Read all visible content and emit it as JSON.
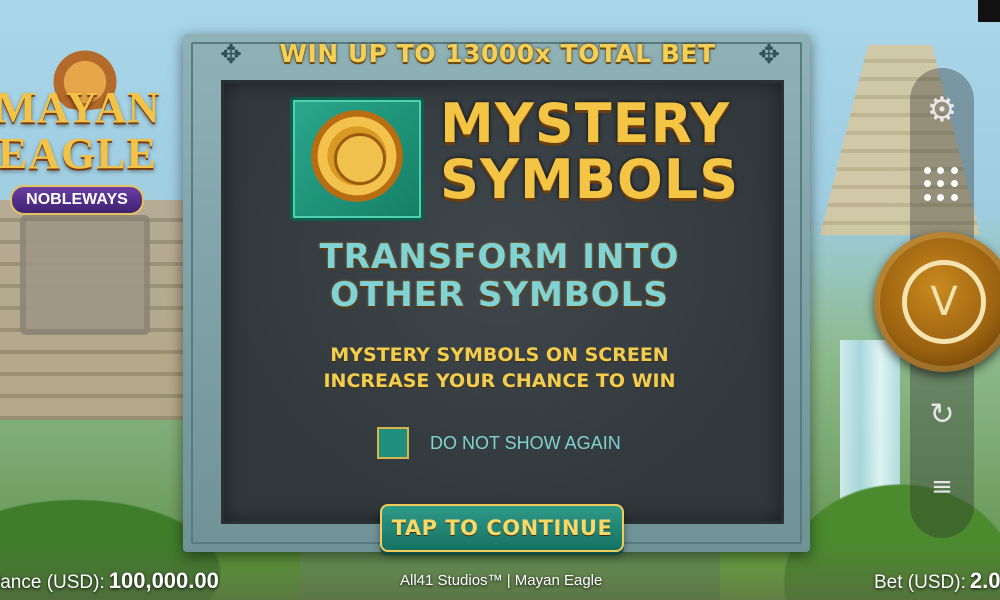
{
  "logo": {
    "line1": "MAYAN",
    "line2": "EAGLE",
    "badge": "NOBLEWAYS"
  },
  "modal": {
    "banner": "WIN UP TO 13000x TOTAL BET",
    "title_line1": "MYSTERY",
    "title_line2": "SYMBOLS",
    "subtitle_line1": "TRANSFORM INTO",
    "subtitle_line2": "OTHER SYMBOLS",
    "description_line1": "MYSTERY SYMBOLS ON SCREEN",
    "description_line2": "INCREASE YOUR CHANCE TO WIN",
    "checkbox_label": "DO NOT SHOW AGAIN",
    "continue_label": "TAP TO CONTINUE"
  },
  "controls": {
    "settings_icon": "gear-icon",
    "menu_icon": "menu-grid-icon",
    "spin_icon": "spin-icon",
    "autoplay_icon": "autoplay-icon",
    "bet_icon": "coin-stack-icon"
  },
  "footer": {
    "balance_label": "lance (USD):",
    "balance_value": "100,000.00",
    "studio": "All41 Studios™ | Mayan Eagle",
    "bet_label": "Bet (USD):",
    "bet_value": "2.0"
  },
  "colors": {
    "gold": "#f4c545",
    "teal": "#7fd3d4",
    "panel": "#3a4246",
    "button": "#1f8676"
  }
}
